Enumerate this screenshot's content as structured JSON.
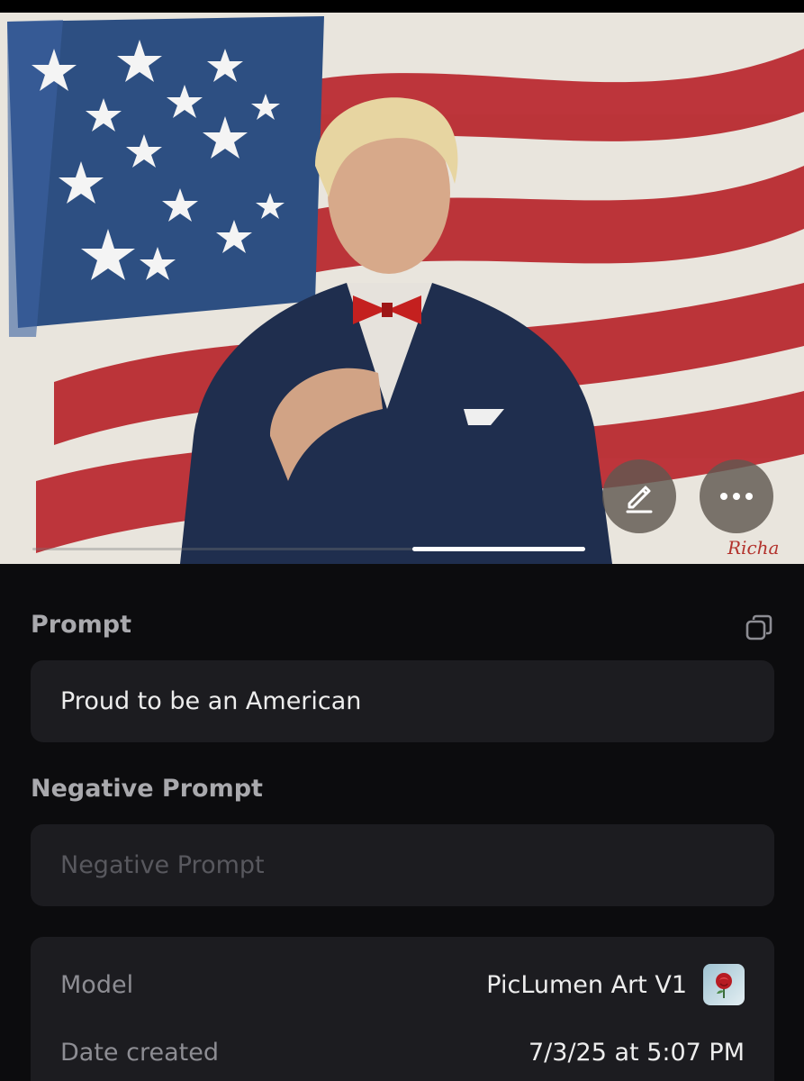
{
  "image": {
    "signature_text": "Richa"
  },
  "actions": {
    "edit_icon": "pencil-icon",
    "more_icon": "ellipsis-icon"
  },
  "gallery": {
    "active_page": 2,
    "total_pages": 3
  },
  "prompt": {
    "label": "Prompt",
    "value": "Proud to be an American",
    "copy_icon": "copy-icon"
  },
  "negative_prompt": {
    "label": "Negative Prompt",
    "placeholder": "Negative Prompt",
    "value": ""
  },
  "details": {
    "model_label": "Model",
    "model_value": "PicLumen Art V1",
    "model_thumb_icon": "rose-thumbnail",
    "date_label": "Date created",
    "date_value": "7/3/25 at 5:07 PM"
  },
  "colors": {
    "background": "#0c0c0e",
    "card": "#1c1c20",
    "label": "#a9a9ad",
    "placeholder": "#58585e"
  }
}
